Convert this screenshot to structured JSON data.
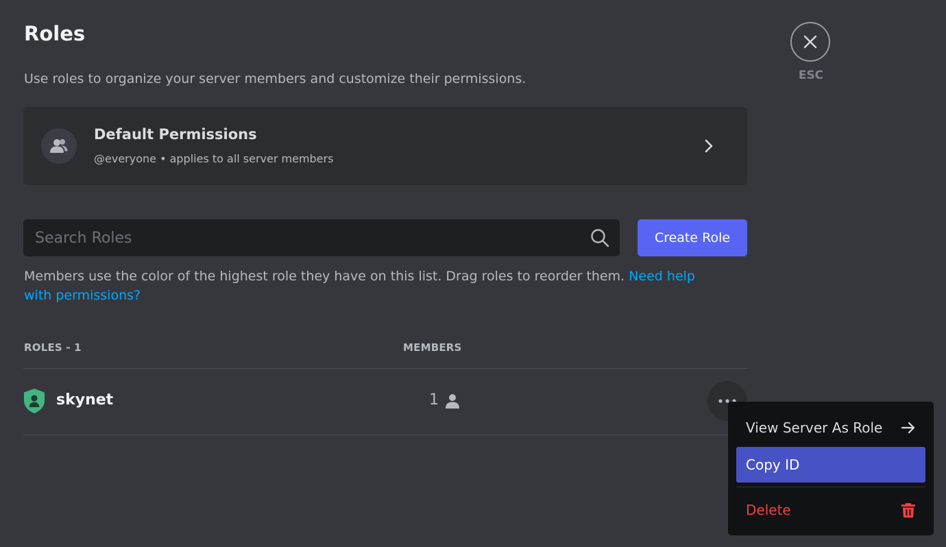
{
  "header": {
    "title": "Roles",
    "subtitle": "Use roles to organize your server members and customize their permissions.",
    "close_label": "ESC"
  },
  "default_permissions": {
    "title": "Default Permissions",
    "description": "@everyone • applies to all server members"
  },
  "search": {
    "placeholder": "Search Roles",
    "value": ""
  },
  "create_role_label": "Create Role",
  "help": {
    "text": "Members use the color of the highest role they have on this list. Drag roles to reorder them. ",
    "link": "Need help with permissions?"
  },
  "table": {
    "roles_header": "ROLES - 1",
    "members_header": "MEMBERS",
    "rows": [
      {
        "name": "skynet",
        "members": "1",
        "color": "#43b581"
      }
    ]
  },
  "context_menu": {
    "view_as_role": "View Server As Role",
    "copy_id": "Copy ID",
    "delete": "Delete"
  },
  "colors": {
    "accent": "#5865f2",
    "highlight": "#4752c4",
    "danger": "#f23f42",
    "link": "#00a8fc"
  }
}
